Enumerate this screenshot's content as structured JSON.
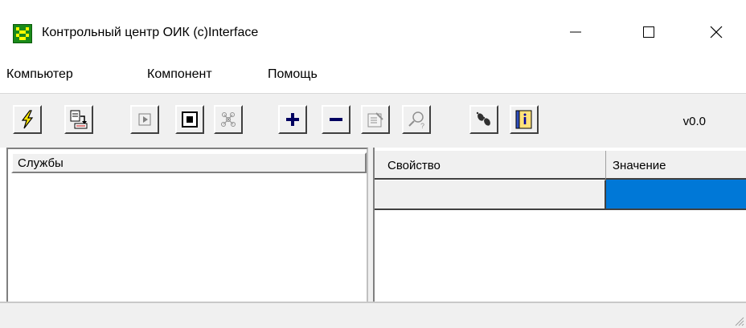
{
  "window": {
    "title": "Контрольный центр ОИК (c)Interface",
    "controls": [
      "minimize",
      "maximize",
      "close"
    ]
  },
  "menu": {
    "items": [
      "Компьютер",
      "Компонент",
      "Помощь"
    ]
  },
  "toolbar": {
    "buttons": [
      {
        "icon": "lightning-icon",
        "enabled": true
      },
      {
        "icon": "document-arrow-icon",
        "enabled": true
      },
      {
        "icon": "play-icon",
        "enabled": false
      },
      {
        "icon": "stop-icon",
        "enabled": true
      },
      {
        "icon": "network-icon",
        "enabled": false
      },
      {
        "icon": "plus-icon",
        "enabled": true
      },
      {
        "icon": "minus-icon",
        "enabled": true
      },
      {
        "icon": "properties-icon",
        "enabled": false
      },
      {
        "icon": "search-icon",
        "enabled": false
      },
      {
        "icon": "footprints-icon",
        "enabled": true
      },
      {
        "icon": "info-book-icon",
        "enabled": true
      }
    ],
    "version": "v0.0"
  },
  "services": {
    "header": "Службы",
    "items": []
  },
  "properties": {
    "columns": [
      "Свойство",
      "Значение"
    ],
    "rows": [
      {
        "property": "",
        "value": ""
      }
    ]
  },
  "colors": {
    "selection": "#0078d7",
    "chrome": "#f0f0f0",
    "icon_green": "#1a8a1a"
  }
}
